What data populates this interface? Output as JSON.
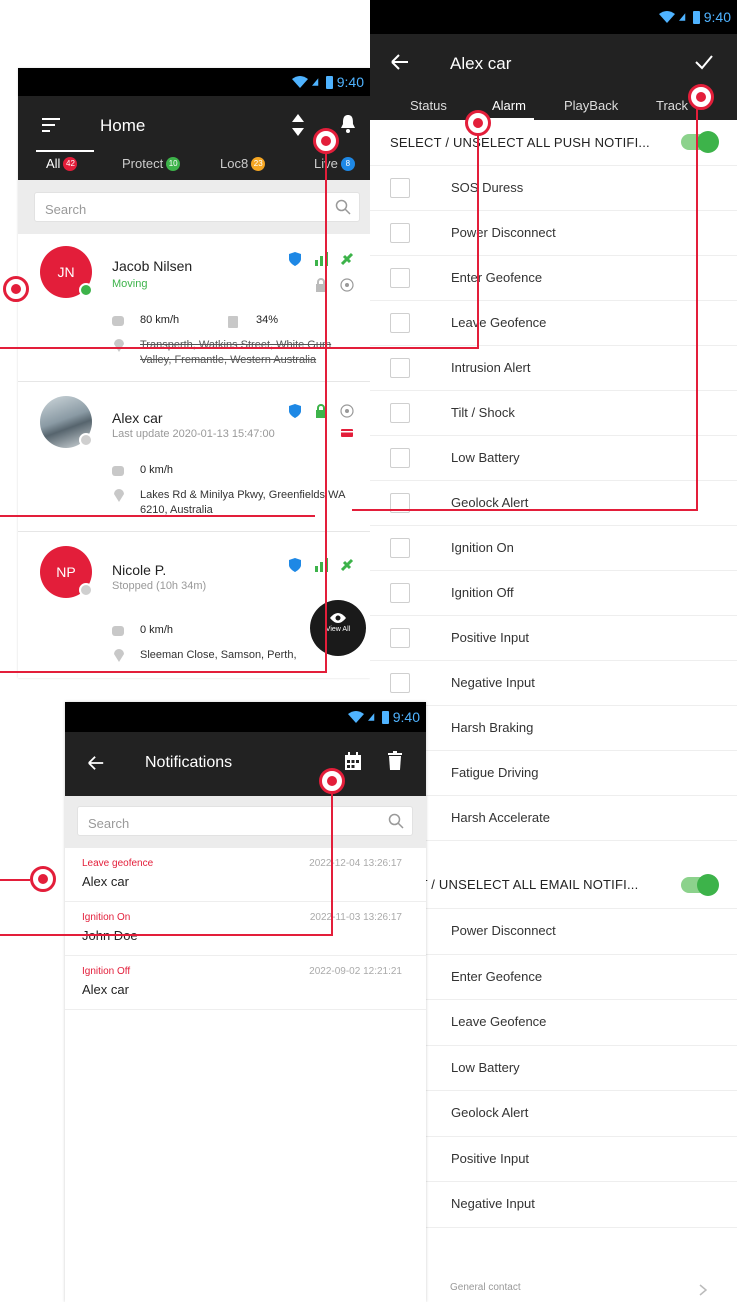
{
  "status_time": "9:40",
  "colors": {
    "accent": "#e31e3a",
    "toolbar": "#222222",
    "online": "#3db34a",
    "blue": "#1e88e5",
    "orange": "#f5a623"
  },
  "home": {
    "title": "Home",
    "tabs": [
      {
        "label": "All",
        "count": "42"
      },
      {
        "label": "Protect",
        "count": "10"
      },
      {
        "label": "Loc8",
        "count": "23"
      },
      {
        "label": "Live",
        "count": "8"
      }
    ],
    "search_placeholder": "Search",
    "vehicles": [
      {
        "initials": "JN",
        "name": "Jacob Nilsen",
        "status": "Moving",
        "speed": "80 km/h",
        "battery": "34%",
        "address": "Transperth, Watkins Street, White Gum Valley, Fremantle, Western Australia"
      },
      {
        "initials": "",
        "name": "Alex car",
        "status": "Last update 2020-01-13 15:47:00",
        "speed": "0 km/h",
        "address": "Lakes Rd & Minilya Pkwy, Greenfields WA 6210, Australia"
      },
      {
        "initials": "NP",
        "name": "Nicole P.",
        "status": "Stopped (10h 34m)",
        "speed": "0 km/h",
        "address": "Sleeman Close, Samson, Perth,"
      }
    ],
    "view_all_label": "View All"
  },
  "alarm": {
    "title": "Alex car",
    "tabs": [
      "Status",
      "Alarm",
      "PlayBack",
      "Track"
    ],
    "push_header": "SELECT / UNSELECT ALL PUSH NOTIFI...",
    "push_items": [
      "SOS Duress",
      "Power Disconnect",
      "Enter Geofence",
      "Leave Geofence",
      "Intrusion Alert",
      "Tilt / Shock",
      "Low Battery",
      "Geolock Alert",
      "Ignition On",
      "Ignition Off",
      "Positive Input",
      "Negative Input",
      "Harsh Braking",
      "Fatigue Driving",
      "Harsh Accelerate"
    ],
    "email_header": "CT / UNSELECT ALL EMAIL NOTIFI...",
    "email_items": [
      "Power Disconnect",
      "Enter Geofence",
      "Leave Geofence",
      "Low Battery",
      "Geolock Alert",
      "Positive Input",
      "Negative Input"
    ],
    "contact_label": "General contact"
  },
  "notifications": {
    "title": "Notifications",
    "search_placeholder": "Search",
    "items": [
      {
        "type": "Leave geofence",
        "name": "Alex car",
        "time": "2022-12-04 13:26:17"
      },
      {
        "type": "Ignition On",
        "name": "John Doe",
        "time": "2022-11-03 13:26:17"
      },
      {
        "type": "Ignition Off",
        "name": "Alex car",
        "time": "2022-09-02 12:21:21"
      }
    ]
  }
}
